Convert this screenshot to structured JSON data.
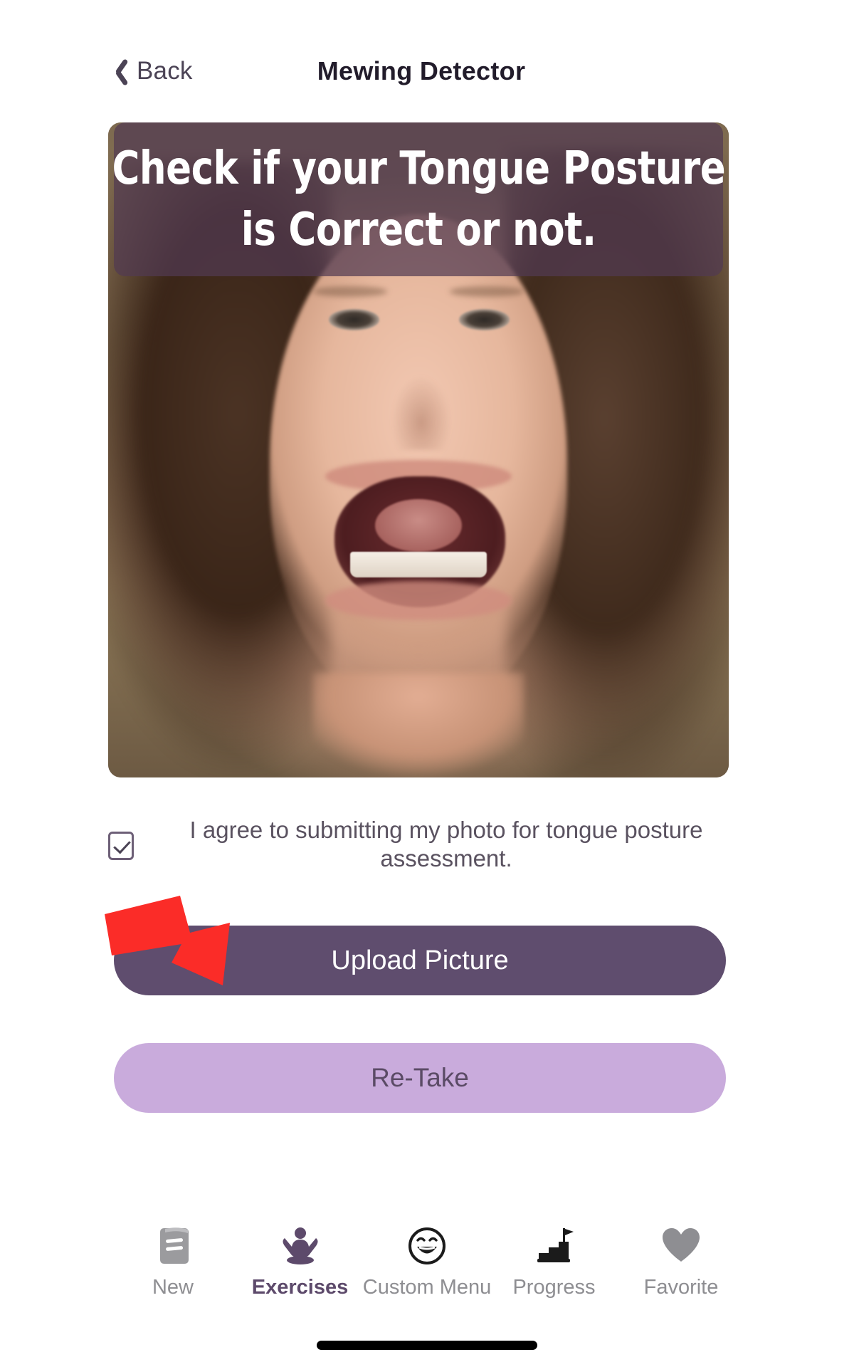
{
  "header": {
    "back_label": "Back",
    "title": "Mewing Detector",
    "back_icon": "chevron-left-icon"
  },
  "photo": {
    "banner_lines": [
      "Check if your Tongue Posture",
      "is Correct or not."
    ],
    "banner_overlay_color": "#523a52",
    "alt": "front-facing photo of a person with open mouth showing tongue posture"
  },
  "consent": {
    "checked": true,
    "text": "I agree to submitting my photo for tongue posture assessment."
  },
  "actions": {
    "upload_label": "Upload Picture",
    "upload_color": "#5f4d6e",
    "retake_label": "Re-Take",
    "retake_color": "#c9abdc"
  },
  "annotation": {
    "arrow_color": "#fb2c28",
    "points_to": "Upload Picture"
  },
  "tabbar": {
    "active_index": 1,
    "active_color": "#5d4a6b",
    "inactive_color": "#8e8e92",
    "items": [
      {
        "label": "New",
        "icon": "book-icon"
      },
      {
        "label": "Exercises",
        "icon": "meditation-figure-icon"
      },
      {
        "label": "Custom Menu",
        "icon": "smiley-face-icon"
      },
      {
        "label": "Progress",
        "icon": "stairs-flag-icon"
      },
      {
        "label": "Favorite",
        "icon": "heart-icon"
      }
    ]
  }
}
